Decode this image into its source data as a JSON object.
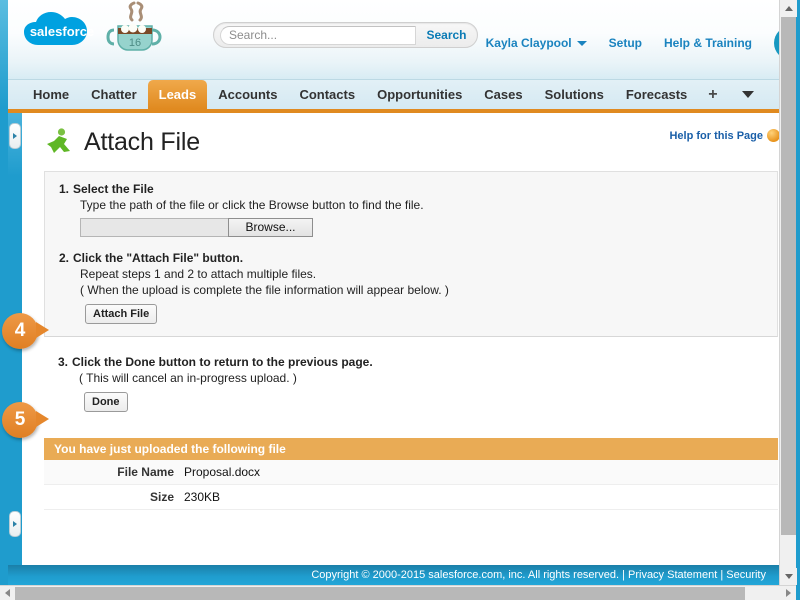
{
  "header": {
    "logo_text": "salesforce",
    "release_badge": "16",
    "release_icon": "cocoa-mug-icon",
    "search": {
      "placeholder": "Search...",
      "value": "",
      "button_label": "Search"
    },
    "user_name": "Kayla Claypool",
    "setup_label": "Setup",
    "help_training_label": "Help & Training"
  },
  "tabs": {
    "items": [
      {
        "label": "Home",
        "active": false
      },
      {
        "label": "Chatter",
        "active": false
      },
      {
        "label": "Leads",
        "active": true
      },
      {
        "label": "Accounts",
        "active": false
      },
      {
        "label": "Contacts",
        "active": false
      },
      {
        "label": "Opportunities",
        "active": false
      },
      {
        "label": "Cases",
        "active": false
      },
      {
        "label": "Solutions",
        "active": false
      },
      {
        "label": "Forecasts",
        "active": false
      }
    ],
    "add_tab_label": "+",
    "more_tabs_label": "all-tabs-dropdown"
  },
  "main": {
    "page_title": "Attach File",
    "page_icon": "leads-running-person-icon",
    "help_link": "Help for this Page",
    "help_icon": "help-orb-icon",
    "steps": [
      {
        "number": "1.",
        "title": "Select the File",
        "description": "Type the path of the file or click the Browse button to find the file.",
        "file_input_value": "",
        "browse_label": "Browse..."
      },
      {
        "number": "2.",
        "title": "Click the \"Attach File\" button.",
        "description": "Repeat steps 1 and 2 to attach multiple files.",
        "note": "( When the upload is complete the file information will appear below. )",
        "button_label": "Attach File"
      },
      {
        "number": "3.",
        "title": "Click the Done button to return to the previous page.",
        "note": "( This will cancel an in-progress upload. )",
        "button_label": "Done"
      }
    ],
    "callouts": [
      {
        "number": "4"
      },
      {
        "number": "5"
      }
    ],
    "upload_result": {
      "header": "You have just uploaded the following file",
      "rows": [
        {
          "label": "File Name",
          "value": "Proposal.docx"
        },
        {
          "label": "Size",
          "value": "230KB"
        }
      ]
    }
  },
  "footer": {
    "copyright": "Copyright © 2000-2015 salesforce.com, inc. All rights reserved.",
    "separator": " | ",
    "privacy_label": "Privacy Statement",
    "security_label": "Security"
  },
  "colors": {
    "brand_blue": "#1f9ccd",
    "accent_orange": "#e08a20",
    "callout_orange": "#e5872c",
    "upload_header": "#e9ab55",
    "link_blue": "#1a83bf"
  }
}
